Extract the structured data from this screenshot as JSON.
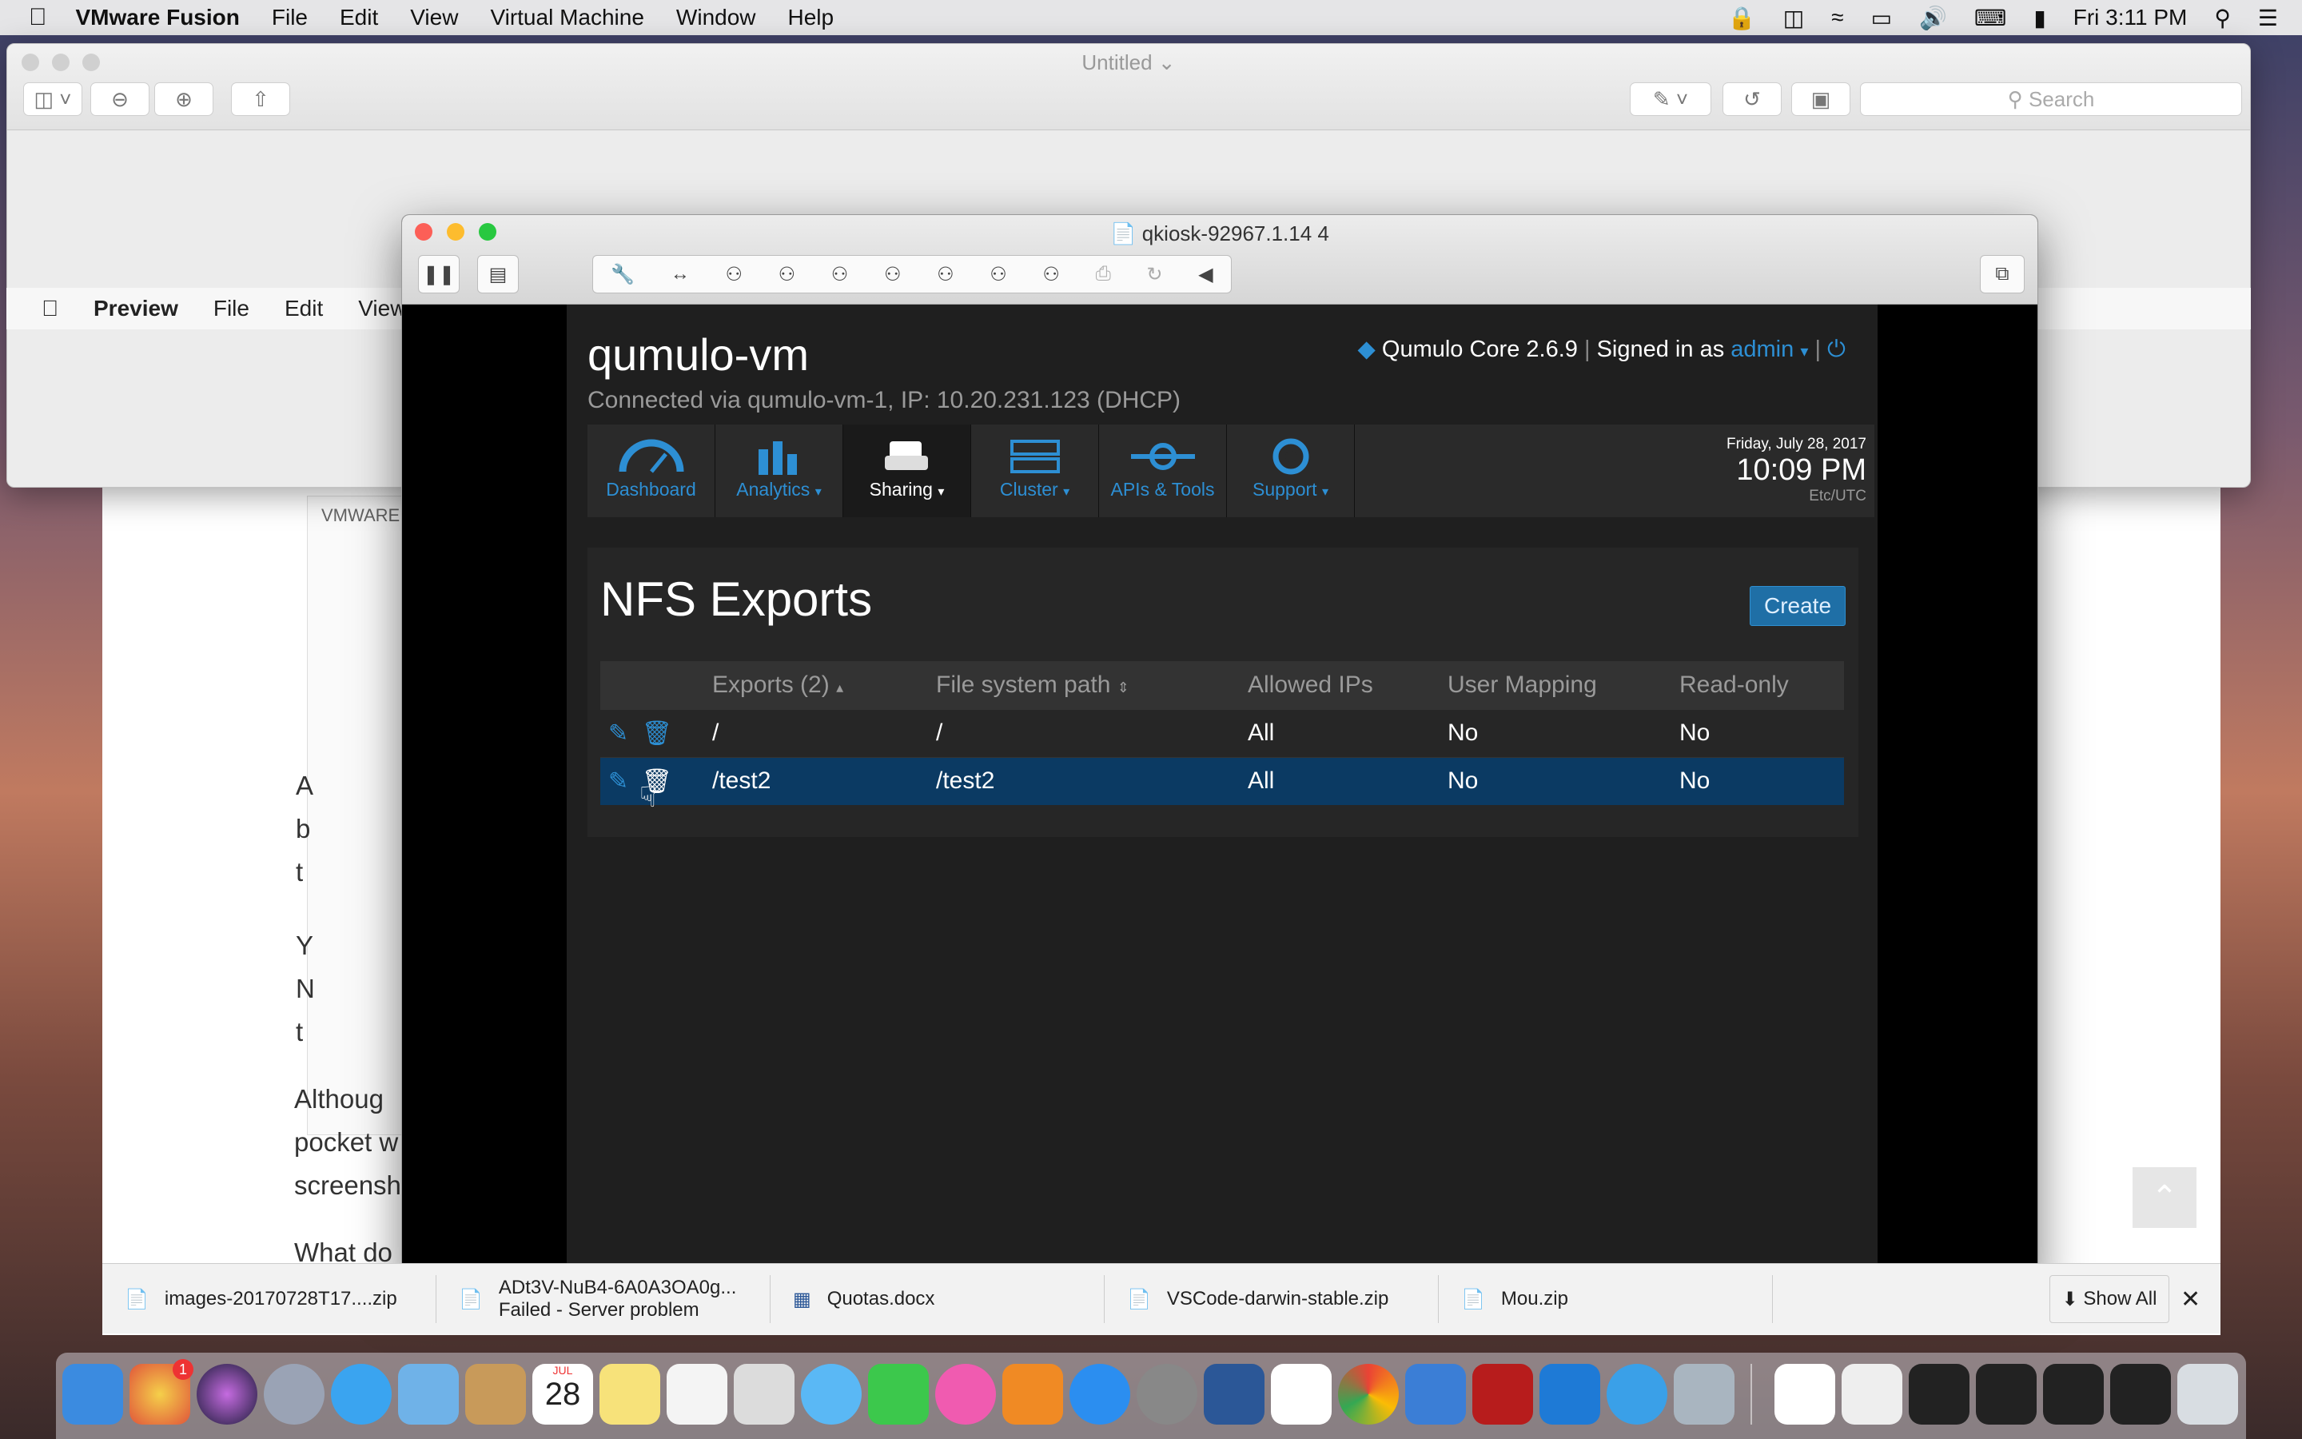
{
  "menubar": {
    "app": "VMware Fusion",
    "items": [
      "File",
      "Edit",
      "View",
      "Virtual Machine",
      "Window",
      "Help"
    ],
    "clock": "Fri 3:11 PM"
  },
  "preview": {
    "title": "Untitled",
    "search_placeholder": "Search",
    "menu_app": "Preview",
    "menu_items": [
      "File",
      "Edit",
      "View"
    ]
  },
  "doc": {
    "label": "VMWARE",
    "lines": [
      "A",
      "b",
      "t",
      "Y",
      "N",
      "t",
      "Althoug",
      "pocket w",
      "screensh",
      "What do"
    ]
  },
  "vm": {
    "title": "qkiosk-92967.1.14 4"
  },
  "app": {
    "host": "qumulo-vm",
    "connection": "Connected via qumulo-vm-1, IP: 10.20.231.123 (DHCP)",
    "version": "Qumulo Core 2.6.9",
    "signed_in": "Signed in as",
    "user": "admin",
    "nav": [
      {
        "label": "Dashboard"
      },
      {
        "label": "Analytics"
      },
      {
        "label": "Sharing"
      },
      {
        "label": "Cluster"
      },
      {
        "label": "APIs & Tools"
      },
      {
        "label": "Support"
      }
    ],
    "date": "Friday, July 28, 2017",
    "time": "10:09 PM",
    "tz": "Etc/UTC"
  },
  "exports": {
    "title": "NFS Exports",
    "create": "Create",
    "columns": [
      "Exports (2)",
      "File system path",
      "Allowed IPs",
      "User Mapping",
      "Read-only"
    ],
    "rows": [
      [
        "/",
        "/",
        "All",
        "No",
        "No"
      ],
      [
        "/test2",
        "/test2",
        "All",
        "No",
        "No"
      ]
    ]
  },
  "downloads": {
    "items": [
      {
        "name": "images-20170728T17....zip",
        "status": ""
      },
      {
        "name": "ADt3V-NuB4-6A0A3OA0g...",
        "status": "Failed - Server problem"
      },
      {
        "name": "Quotas.docx",
        "status": ""
      },
      {
        "name": "VSCode-darwin-stable.zip",
        "status": ""
      },
      {
        "name": "Mou.zip",
        "status": ""
      }
    ],
    "show_all": "Show All"
  },
  "dock": {
    "calendar_day": "28",
    "calendar_month": "JUL",
    "badge": "1"
  }
}
